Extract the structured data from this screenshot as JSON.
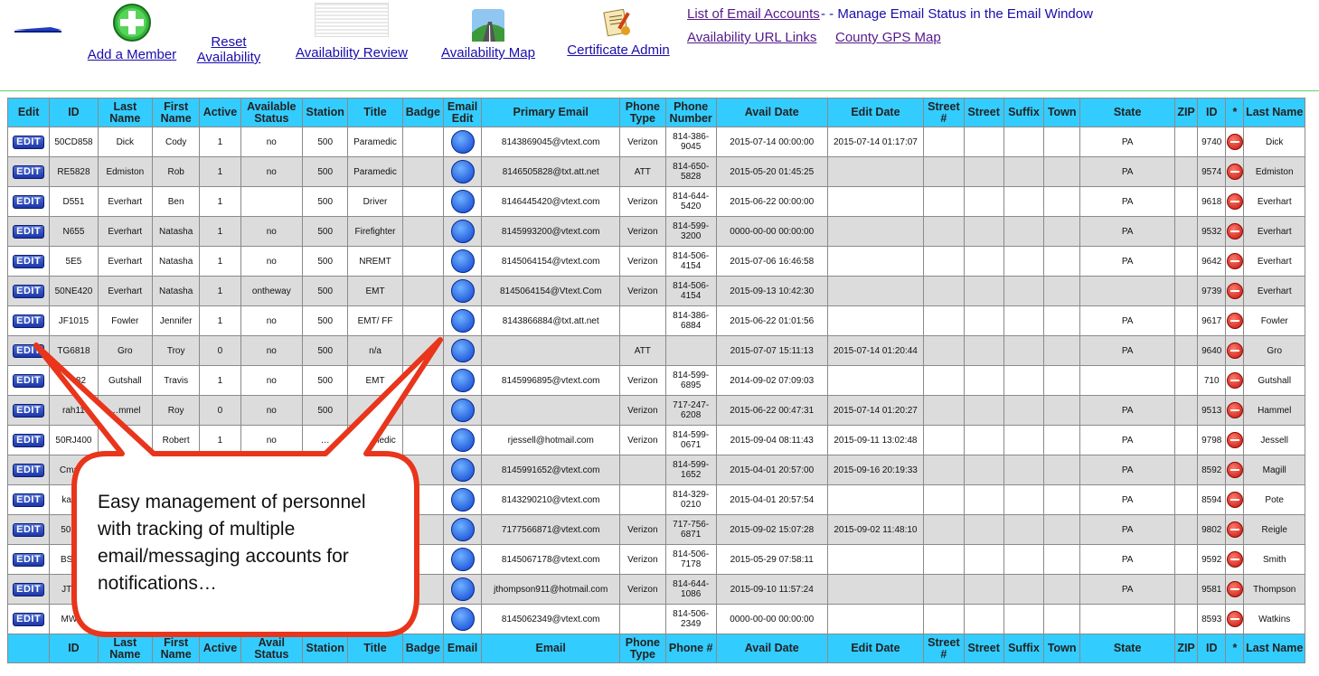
{
  "nav": {
    "add_member": "Add a Member",
    "reset_availability_1": "Reset",
    "reset_availability_2": "Availability",
    "availability_review": "Availability Review",
    "availability_map": "Availability Map",
    "certificate_admin": "Certificate Admin",
    "list_email_accounts": "List of Email Accounts",
    "manage_email_status": " - - Manage Email Status in the Email Window",
    "availability_url_links": "Availability URL Links",
    "county_gps_map": "County GPS Map"
  },
  "table": {
    "header": [
      "Edit",
      "ID",
      "Last Name",
      "First Name",
      "Active",
      "Available Status",
      "Station",
      "Title",
      "Badge",
      "Email Edit",
      "Primary Email",
      "Phone Type",
      "Phone Number",
      "Avail Date",
      "Edit Date",
      "Street #",
      "Street",
      "Suffix",
      "Town",
      "State",
      "ZIP",
      "ID",
      "*",
      "Last Name"
    ],
    "footer": [
      "",
      "ID",
      "Last Name",
      "First Name",
      "Active",
      "Avail Status",
      "Station",
      "Title",
      "Badge",
      "Email",
      "Email",
      "Phone Type",
      "Phone #",
      "Avail Date",
      "Edit Date",
      "Street #",
      "Street",
      "Suffix",
      "Town",
      "State",
      "ZIP",
      "ID",
      "*",
      "Last Name"
    ],
    "edit_label": "EDIT",
    "rows": [
      {
        "id": "50CD858",
        "last": "Dick",
        "first": "Cody",
        "active": "1",
        "status": "no",
        "station": "500",
        "title": "Paramedic",
        "badge": "",
        "email": "8143869045@vtext.com",
        "phone_type": "Verizon",
        "phone": "814-386-9045",
        "avail_date": "2015-07-14 00:00:00",
        "edit_date": "2015-07-14 01:17:07",
        "state": "PA",
        "id2": "9740",
        "last2": "Dick"
      },
      {
        "id": "RE5828",
        "last": "Edmiston",
        "first": "Rob",
        "active": "1",
        "status": "no",
        "station": "500",
        "title": "Paramedic",
        "badge": "",
        "email": "8146505828@txt.att.net",
        "phone_type": "ATT",
        "phone": "814-650-5828",
        "avail_date": "2015-05-20 01:45:25",
        "edit_date": "",
        "state": "PA",
        "id2": "9574",
        "last2": "Edmiston"
      },
      {
        "id": "D551",
        "last": "Everhart",
        "first": "Ben",
        "active": "1",
        "status": "",
        "station": "500",
        "title": "Driver",
        "badge": "",
        "email": "8146445420@vtext.com",
        "phone_type": "Verizon",
        "phone": "814-644-5420",
        "avail_date": "2015-06-22 00:00:00",
        "edit_date": "",
        "state": "PA",
        "id2": "9618",
        "last2": "Everhart"
      },
      {
        "id": "N655",
        "last": "Everhart",
        "first": "Natasha",
        "active": "1",
        "status": "no",
        "station": "500",
        "title": "Firefighter",
        "badge": "",
        "email": "8145993200@vtext.com",
        "phone_type": "Verizon",
        "phone": "814-599-3200",
        "avail_date": "0000-00-00 00:00:00",
        "edit_date": "",
        "state": "PA",
        "id2": "9532",
        "last2": "Everhart"
      },
      {
        "id": "5E5",
        "last": "Everhart",
        "first": "Natasha",
        "active": "1",
        "status": "no",
        "station": "500",
        "title": "NREMT",
        "badge": "",
        "email": "8145064154@vtext.com",
        "phone_type": "Verizon",
        "phone": "814-506-4154",
        "avail_date": "2015-07-06 16:46:58",
        "edit_date": "",
        "state": "PA",
        "id2": "9642",
        "last2": "Everhart"
      },
      {
        "id": "50NE420",
        "last": "Everhart",
        "first": "Natasha",
        "active": "1",
        "status": "ontheway",
        "station": "500",
        "title": "EMT",
        "badge": "",
        "email": "8145064154@Vtext.Com",
        "phone_type": "Verizon",
        "phone": "814-506-4154",
        "avail_date": "2015-09-13 10:42:30",
        "edit_date": "",
        "state": "",
        "id2": "9739",
        "last2": "Everhart"
      },
      {
        "id": "JF1015",
        "last": "Fowler",
        "first": "Jennifer",
        "active": "1",
        "status": "no",
        "station": "500",
        "title": "EMT/ FF",
        "badge": "",
        "email": "8143866884@txt.att.net",
        "phone_type": "",
        "phone": "814-386-6884",
        "avail_date": "2015-06-22 01:01:56",
        "edit_date": "",
        "state": "PA",
        "id2": "9617",
        "last2": "Fowler"
      },
      {
        "id": "TG6818",
        "last": "Gro",
        "first": "Troy",
        "active": "0",
        "status": "no",
        "station": "500",
        "title": "n/a",
        "badge": "",
        "email": "",
        "phone_type": "ATT",
        "phone": "",
        "avail_date": "2015-07-07 15:11:13",
        "edit_date": "2015-07-14 01:20:44",
        "state": "PA",
        "id2": "9640",
        "last2": "Gro"
      },
      {
        "id": "T…82",
        "last": "Gutshall",
        "first": "Travis",
        "active": "1",
        "status": "no",
        "station": "500",
        "title": "EMT",
        "badge": "",
        "email": "8145996895@vtext.com",
        "phone_type": "Verizon",
        "phone": "814-599-6895",
        "avail_date": "2014-09-02 07:09:03",
        "edit_date": "",
        "state": "",
        "id2": "710",
        "last2": "Gutshall"
      },
      {
        "id": "rah11",
        "last": "…mmel",
        "first": "Roy",
        "active": "0",
        "status": "no",
        "station": "500",
        "title": "",
        "badge": "",
        "email": "",
        "phone_type": "Verizon",
        "phone": "717-247-6208",
        "avail_date": "2015-06-22 00:47:31",
        "edit_date": "2015-07-14 01:20:27",
        "state": "PA",
        "id2": "9513",
        "last2": "Hammel"
      },
      {
        "id": "50RJ400",
        "last": "J…",
        "first": "Robert",
        "active": "1",
        "status": "no",
        "station": "…",
        "title": "…ramedic",
        "badge": "",
        "email": "rjessell@hotmail.com",
        "phone_type": "Verizon",
        "phone": "814-599-0671",
        "avail_date": "2015-09-04 08:11:43",
        "edit_date": "2015-09-11 13:02:48",
        "state": "PA",
        "id2": "9798",
        "last2": "Jessell"
      },
      {
        "id": "Cma…",
        "last": "",
        "first": "",
        "active": "",
        "status": "",
        "station": "",
        "title": "",
        "badge": "",
        "email": "8145991652@vtext.com",
        "phone_type": "",
        "phone": "814-599-1652",
        "avail_date": "2015-04-01 20:57:00",
        "edit_date": "2015-09-16 20:19:33",
        "state": "PA",
        "id2": "8592",
        "last2": "Magill"
      },
      {
        "id": "kap…",
        "last": "",
        "first": "",
        "active": "",
        "status": "",
        "station": "",
        "title": "",
        "badge": "",
        "email": "8143290210@vtext.com",
        "phone_type": "",
        "phone": "814-329-0210",
        "avail_date": "2015-04-01 20:57:54",
        "edit_date": "",
        "state": "PA",
        "id2": "8594",
        "last2": "Pote"
      },
      {
        "id": "50R…",
        "last": "",
        "first": "",
        "active": "",
        "status": "",
        "station": "",
        "title": "",
        "badge": "",
        "email": "7177566871@vtext.com",
        "phone_type": "Verizon",
        "phone": "717-756-6871",
        "avail_date": "2015-09-02 15:07:28",
        "edit_date": "2015-09-02 11:48:10",
        "state": "PA",
        "id2": "9802",
        "last2": "Reigle"
      },
      {
        "id": "BS7…",
        "last": "",
        "first": "",
        "active": "",
        "status": "",
        "station": "",
        "title": "",
        "badge": "",
        "email": "8145067178@vtext.com",
        "phone_type": "Verizon",
        "phone": "814-506-7178",
        "avail_date": "2015-05-29 07:58:11",
        "edit_date": "",
        "state": "PA",
        "id2": "9592",
        "last2": "Smith"
      },
      {
        "id": "JT9…",
        "last": "",
        "first": "",
        "active": "",
        "status": "",
        "station": "",
        "title": "",
        "badge": "",
        "email": "jthompson911@hotmail.com",
        "phone_type": "Verizon",
        "phone": "814-644-1086",
        "avail_date": "2015-09-10 11:57:24",
        "edit_date": "",
        "state": "PA",
        "id2": "9581",
        "last2": "Thompson"
      },
      {
        "id": "MW…",
        "last": "",
        "first": "",
        "active": "",
        "status": "",
        "station": "",
        "title": "",
        "badge": "",
        "email": "8145062349@vtext.com",
        "phone_type": "",
        "phone": "814-506-2349",
        "avail_date": "0000-00-00 00:00:00",
        "edit_date": "",
        "state": "",
        "id2": "8593",
        "last2": "Watkins"
      }
    ]
  },
  "callout": {
    "text": "Easy management of personnel with tracking of multiple email/messaging accounts for notifications…"
  },
  "colors": {
    "header_bg": "#33ccff",
    "callout_border": "#e8351b",
    "link": "#1a0dab",
    "visited_link": "#551a8b"
  }
}
